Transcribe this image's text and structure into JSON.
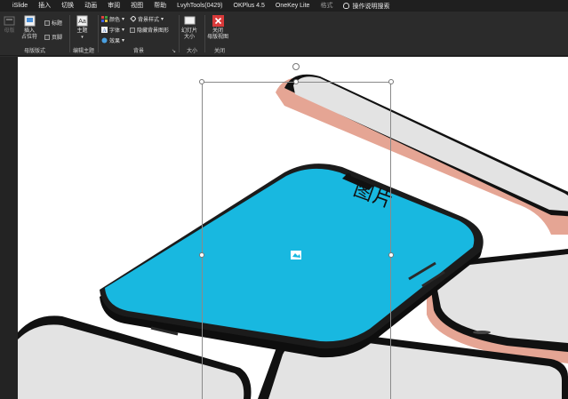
{
  "tabs": [
    "iSlide",
    "插入",
    "切换",
    "动画",
    "审阅",
    "视图",
    "帮助",
    "LvyhTools(0429)",
    "OKPlus 4.5",
    "OneKey Lite",
    "格式"
  ],
  "tell_me": "操作说明搜索",
  "ribbon": {
    "master_layout": {
      "label": "母版版式",
      "master_btn": "母版",
      "insert_placeholder": "插入\n占位符",
      "title_chk": "标题",
      "footer_chk": "页脚"
    },
    "edit_theme": {
      "label": "编辑主题",
      "theme_btn": "主题"
    },
    "background": {
      "label": "背景",
      "colors": "颜色",
      "fonts": "字体",
      "effects": "效果",
      "bg_styles": "背景样式",
      "hide_bg": "隐藏背景图形"
    },
    "size": {
      "label": "大小",
      "slide_size": "幻灯片\n大小"
    },
    "close": {
      "label": "关闭",
      "close_master": "关闭\n母版视图"
    }
  },
  "canvas": {
    "placeholder_text": "图片",
    "accent_color": "#18b8e0"
  }
}
